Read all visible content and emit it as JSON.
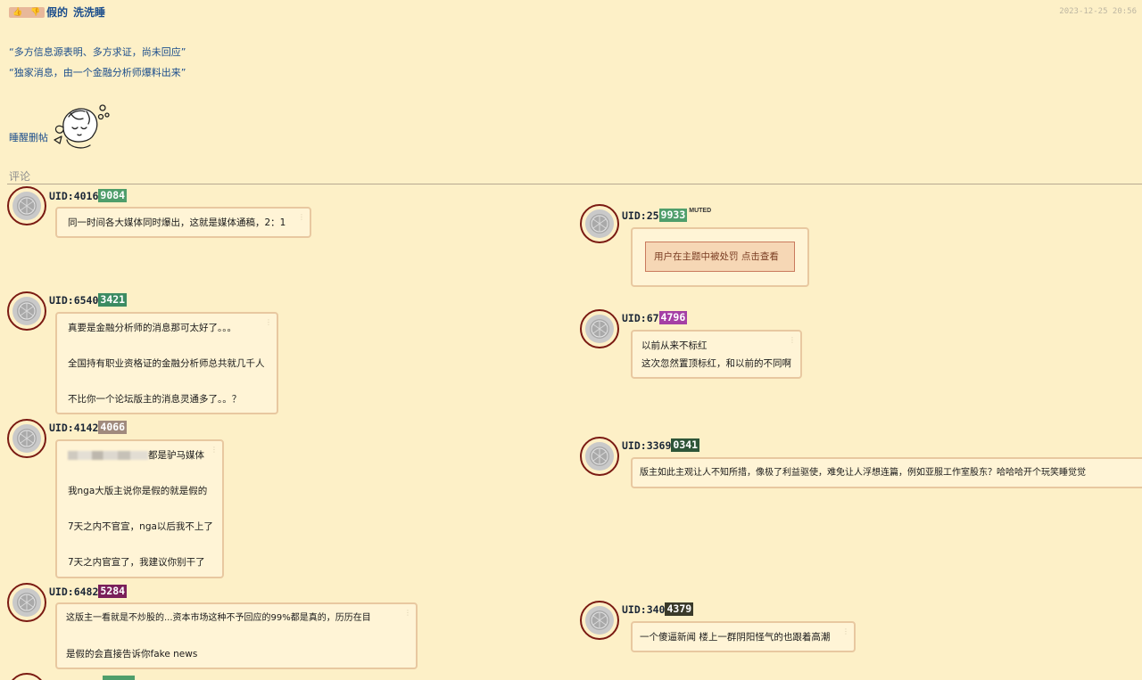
{
  "post": {
    "vote_up": "👍",
    "vote_down": "👎",
    "title_part1": "假的",
    "title_part2": "洗洗睡",
    "date": "2023-12-25 20:56",
    "quote1": "“多方信息源表明、多方求证，尚未回应”",
    "quote2": "“独家消息，由一个金融分析师爆料出来”",
    "footer_link": "睡醒删帖"
  },
  "comments_label": "评论",
  "comments": [
    {
      "uid_prefix": "UID:4016",
      "uid_tag": "9084",
      "tag_color": "#4f9e6b",
      "lines": [
        "同一时间各大媒体同时爆出，这就是媒体通稿，2：1"
      ]
    },
    {
      "uid_prefix": "UID:25",
      "uid_tag": "9933",
      "tag_color": "#4f9e6b",
      "muted": "MUTED",
      "penalty": "用户在主题中被处罚 点击查看"
    },
    {
      "uid_prefix": "UID:6540",
      "uid_tag": "3421",
      "tag_color": "#3c8b62",
      "lines": [
        "真要是金融分析师的消息那可太好了。。。",
        "全国持有职业资格证的金融分析师总共就几千人",
        "不比你一个论坛版主的消息灵通多了。。？"
      ]
    },
    {
      "uid_prefix": "UID:67",
      "uid_tag": "4796",
      "tag_color": "#a540a5",
      "lines": [
        "以前从来不标红",
        "这次忽然置顶标红，和以前的不同啊"
      ]
    },
    {
      "uid_prefix": "UID:4142",
      "uid_tag": "4066",
      "tag_color": "#a08a7d",
      "lines": [
        "都是驴马媒体",
        "我nga大版主说你是假的就是假的",
        "7天之内不官宣，nga以后我不上了",
        "7天之内官宣了，我建议你别干了"
      ]
    },
    {
      "uid_prefix": "UID:3369",
      "uid_tag": "0341",
      "tag_color": "#2e5538",
      "lines": [
        "版主如此主观让人不知所措，像极了利益驱使，难免让人浮想连篇，例如亚服工作室股东？哈哈哈开个玩笑睡觉觉"
      ]
    },
    {
      "uid_prefix": "UID:6482",
      "uid_tag": "5284",
      "tag_color": "#7a1f5a",
      "lines": [
        "这版主一看就是不炒股的...资本市场这种不予回应的99%都是真的，历历在目",
        "是假的会直接告诉你fake news"
      ]
    },
    {
      "uid_prefix": "UID:340",
      "uid_tag": "4379",
      "tag_color": "#3a3a2a",
      "lines": [
        "一个傻逼新闻 楼上一群阴阳怪气的也跟着高潮"
      ]
    }
  ]
}
